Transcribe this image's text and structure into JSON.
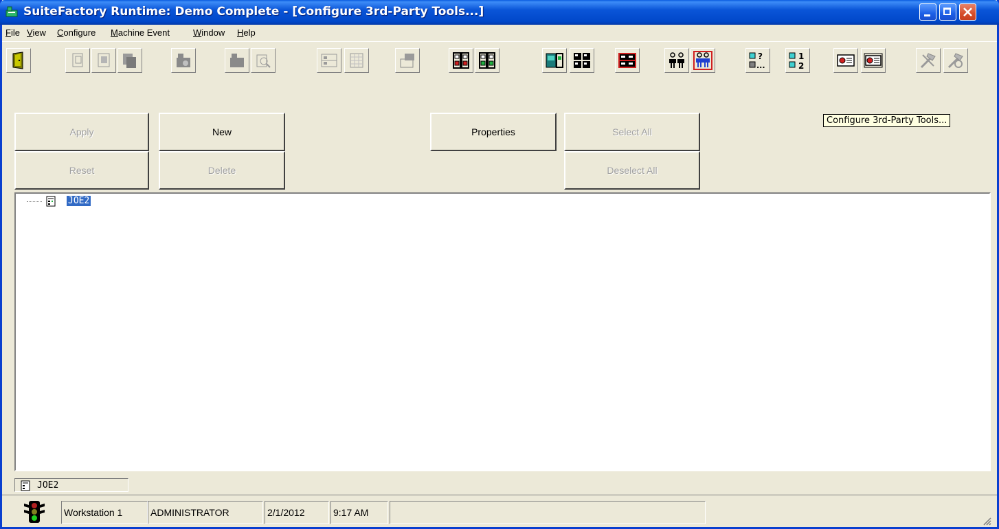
{
  "window": {
    "title": "SuiteFactory Runtime: Demo Complete - [Configure 3rd-Party Tools...]"
  },
  "menu": [
    {
      "label": "File",
      "ul": "F",
      "rest": "ile"
    },
    {
      "label": "View",
      "ul": "V",
      "rest": "iew"
    },
    {
      "label": "Configure",
      "ul": "C",
      "rest": "onfigure"
    },
    {
      "label": "Machine Event",
      "ul": "M",
      "rest": "achine Event"
    },
    {
      "label": "Window",
      "ul": "W",
      "rest": "indow"
    },
    {
      "label": "Help",
      "ul": "H",
      "rest": "elp"
    }
  ],
  "tooltip": "Configure 3rd-Party Tools...",
  "actions": {
    "apply": "Apply",
    "reset": "Reset",
    "new": "New",
    "delete": "Delete",
    "properties": "Properties",
    "select_all": "Select All",
    "deselect_all": "Deselect All"
  },
  "tree": {
    "root": "JOE2"
  },
  "selection": "JOE2",
  "status": {
    "workstation": "Workstation 1",
    "user": "ADMINISTRATOR",
    "date": "2/1/2012",
    "time": "9:17 AM"
  },
  "colors": {
    "titlebar": "#0a55d8",
    "selection": "#316ac5",
    "background": "#ece9d8",
    "tooltip": "#ffffe1"
  }
}
